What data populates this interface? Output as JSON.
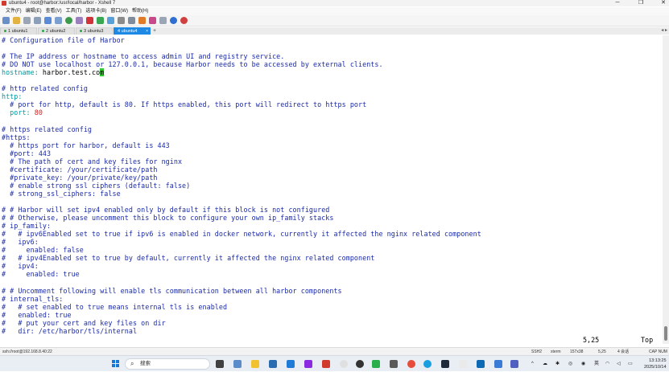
{
  "window": {
    "title": "ubuntu4 - root@harbor:/usr/local/harbor - Xshell 7",
    "controls": [
      "─",
      "❐",
      "✕"
    ]
  },
  "menu": [
    "文件(F)",
    "编辑(E)",
    "查看(V)",
    "工具(T)",
    "选项卡(B)",
    "窗口(W)",
    "帮助(H)"
  ],
  "tabs": [
    {
      "label": "1 ubuntu1",
      "active": false
    },
    {
      "label": "2 ubuntu2",
      "active": false
    },
    {
      "label": "3 ubuntu3",
      "active": false
    },
    {
      "label": "4 ubuntu4",
      "active": true
    }
  ],
  "tab_add": "+",
  "terminal": {
    "lines": [
      {
        "text": "# Configuration file of Harbor",
        "color": "blue"
      },
      {
        "text": "",
        "color": "blk"
      },
      {
        "text": "# The IP address or hostname to access admin UI and registry service.",
        "color": "blue"
      },
      {
        "text": "# DO NOT use localhost or 127.0.0.1, because Harbor needs to be accessed by external clients.",
        "color": "blue"
      },
      {
        "text": "hostname: harbor.test.co",
        "cursor": "m",
        "color": "mixed-host"
      },
      {
        "text": "",
        "color": "blk"
      },
      {
        "text": "# http related config",
        "color": "blue"
      },
      {
        "text": "http:",
        "color": "cyan"
      },
      {
        "text": "  # port for http, default is 80. If https enabled, this port will redirect to https port",
        "color": "blue"
      },
      {
        "text": "  port: 80",
        "color": "mixed-port"
      },
      {
        "text": "",
        "color": "blk"
      },
      {
        "text": "# https related config",
        "color": "blue"
      },
      {
        "text": "#https:",
        "color": "blue"
      },
      {
        "text": "  # https port for harbor, default is 443",
        "color": "blue"
      },
      {
        "text": "  #port: 443",
        "color": "blue"
      },
      {
        "text": "  # The path of cert and key files for nginx",
        "color": "blue"
      },
      {
        "text": "  #certificate: /your/certificate/path",
        "color": "blue"
      },
      {
        "text": "  #private_key: /your/private/key/path",
        "color": "blue"
      },
      {
        "text": "  # enable strong ssl ciphers (default: false)",
        "color": "blue"
      },
      {
        "text": "  # strong_ssl_ciphers: false",
        "color": "blue"
      },
      {
        "text": "",
        "color": "blk"
      },
      {
        "text": "# # Harbor will set ipv4 enabled only by default if this block is not configured",
        "color": "blue"
      },
      {
        "text": "# # Otherwise, please uncomment this block to configure your own ip_family stacks",
        "color": "blue"
      },
      {
        "text": "# ip_family:",
        "color": "blue"
      },
      {
        "text": "#   # ipv6Enabled set to true if ipv6 is enabled in docker network, currently it affected the nginx related component",
        "color": "blue"
      },
      {
        "text": "#   ipv6:",
        "color": "blue"
      },
      {
        "text": "#     enabled: false",
        "color": "blue"
      },
      {
        "text": "#   # ipv4Enabled set to true by default, currently it affected the nginx related component",
        "color": "blue"
      },
      {
        "text": "#   ipv4:",
        "color": "blue"
      },
      {
        "text": "#     enabled: true",
        "color": "blue"
      },
      {
        "text": "",
        "color": "blk"
      },
      {
        "text": "# # Uncomment following will enable tls communication between all harbor components",
        "color": "blue"
      },
      {
        "text": "# internal_tls:",
        "color": "blue"
      },
      {
        "text": "#   # set enabled to true means internal tls is enabled",
        "color": "blue"
      },
      {
        "text": "#   enabled: true",
        "color": "blue"
      },
      {
        "text": "#   # put your cert and key files on dir",
        "color": "blue"
      },
      {
        "text": "#   dir: /etc/harbor/tls/internal",
        "color": "blue"
      }
    ],
    "hostname_key": "hostname:",
    "hostname_value": " harbor.test.co",
    "cursor_char": "m",
    "port_key": "  port:",
    "port_value": " 80",
    "cursor_position": "5,25",
    "scroll_position": "Top"
  },
  "statusbar": {
    "connection": "ssh://root@192.168.8.40:22",
    "protocol": "SSH2",
    "terminal_type": "xterm",
    "size": "157x38",
    "cursor": "5,25",
    "sessions": "4 会话",
    "caps": "CAP NUM"
  },
  "taskbar": {
    "search_placeholder": "搜索",
    "language": "英",
    "time": "13:13:25",
    "date": "2025/10/14"
  },
  "colors": {
    "comment": "#1a2aa8",
    "key": "#009aa0",
    "value_number": "#cc1f1f",
    "cursor": "#32c832",
    "active_tab": "#1e88e5"
  }
}
